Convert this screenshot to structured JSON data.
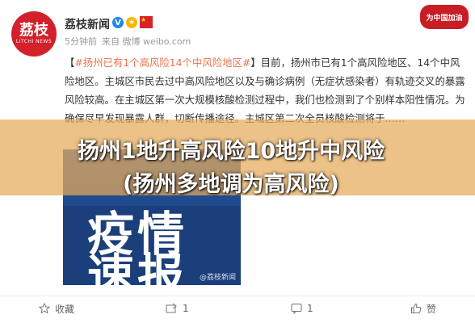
{
  "header": {
    "avatar_text": "荔枝",
    "avatar_subtext": "LITCHI NEWS",
    "username": "荔枝新闻",
    "verified_badge": "V",
    "time": "5分钟前",
    "source": "来自 微博 weibo.com",
    "corner_logo": "为中国加油"
  },
  "post": {
    "bracket_open": "【",
    "hashtag": "#扬州已有1个高风险14个中风险地区#",
    "bracket_close": "】",
    "text": "目前，扬州市已有1个高风险地区、14个中风险地区。主城区市民去过中高风险地区以及与确诊病例（无症状感染者）有轨迹交叉的暴露风险较高。在主城区第一次大规模核酸检测过程中，我们也检测到了个别样本阳性情况。为确保尽早发现暴露人群，切断传播途径。主城区第二次全员核酸检测将于……"
  },
  "photo": {
    "line1": "疫情",
    "line2": "速报",
    "watermark": "@荔枝新闻"
  },
  "overlay": {
    "line1": "扬州1地升高风险10地升中风险",
    "line2": "(扬州多地调为高风险)"
  },
  "actions": {
    "favorite": "收藏",
    "repost": "1",
    "comment": "1",
    "like": "赞"
  },
  "colors": {
    "brand_red": "#d4202a",
    "hashtag": "#eb7350",
    "overlay_band": "#e6aa5a"
  }
}
